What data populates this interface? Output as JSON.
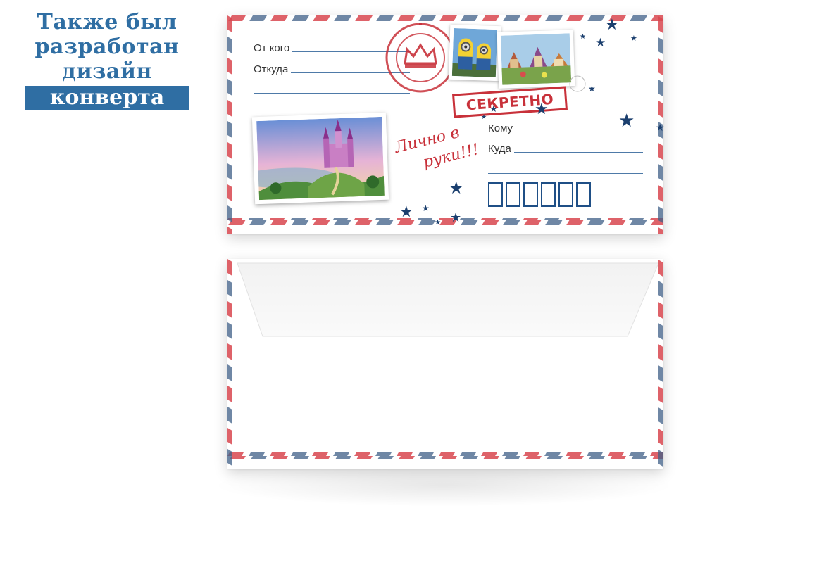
{
  "headline": {
    "line1": "Также был",
    "line2": "разработан",
    "line3": "дизайн",
    "highlight": "конверта"
  },
  "front": {
    "from_label": "От кого",
    "from_where_label": "Откуда",
    "to_label": "Кому",
    "to_where_label": "Куда",
    "stamp_text": "СЕКРЕТНО",
    "handwritten_line1": "Лично в",
    "handwritten_line2": "руки!!!",
    "index_box_count": 6
  },
  "colors": {
    "brand_blue": "#2f6ea3",
    "stripe_red": "#d9474f",
    "stripe_blue": "#3e5f86",
    "stamp_red": "#c8313a",
    "star_navy": "#1b3f6e"
  },
  "icons": [
    "star-icon",
    "crown-icon"
  ]
}
